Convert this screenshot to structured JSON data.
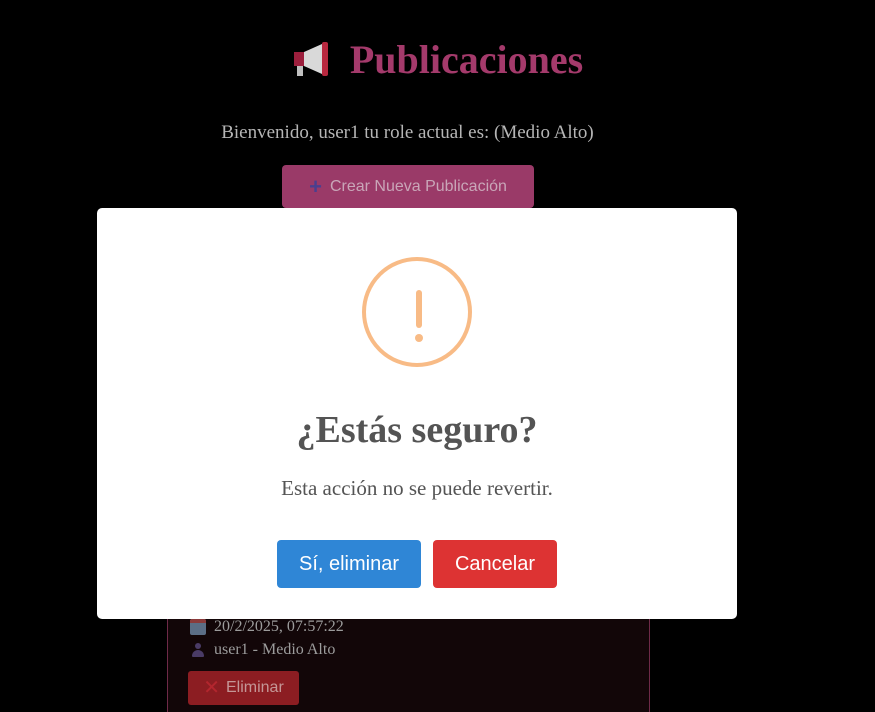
{
  "header": {
    "icon": "megaphone-icon",
    "title": "Publicaciones"
  },
  "welcome": {
    "text": "Bienvenido, user1 tu role actual es: (Medio Alto)"
  },
  "create_button": {
    "icon": "plus-icon",
    "label": "Crear Nueva Publicación"
  },
  "post": {
    "date": "20/2/2025, 07:57:22",
    "author": "user1 - Medio Alto",
    "delete_label": "Eliminar"
  },
  "modal": {
    "icon": "warning-icon",
    "title": "¿Estás seguro?",
    "text": "Esta acción no se puede revertir.",
    "confirm_label": "Sí, eliminar",
    "cancel_label": "Cancelar"
  },
  "colors": {
    "accent": "#a43a6b",
    "confirm": "#2f86d6",
    "cancel": "#dd3333",
    "warning": "#f8bb86"
  }
}
